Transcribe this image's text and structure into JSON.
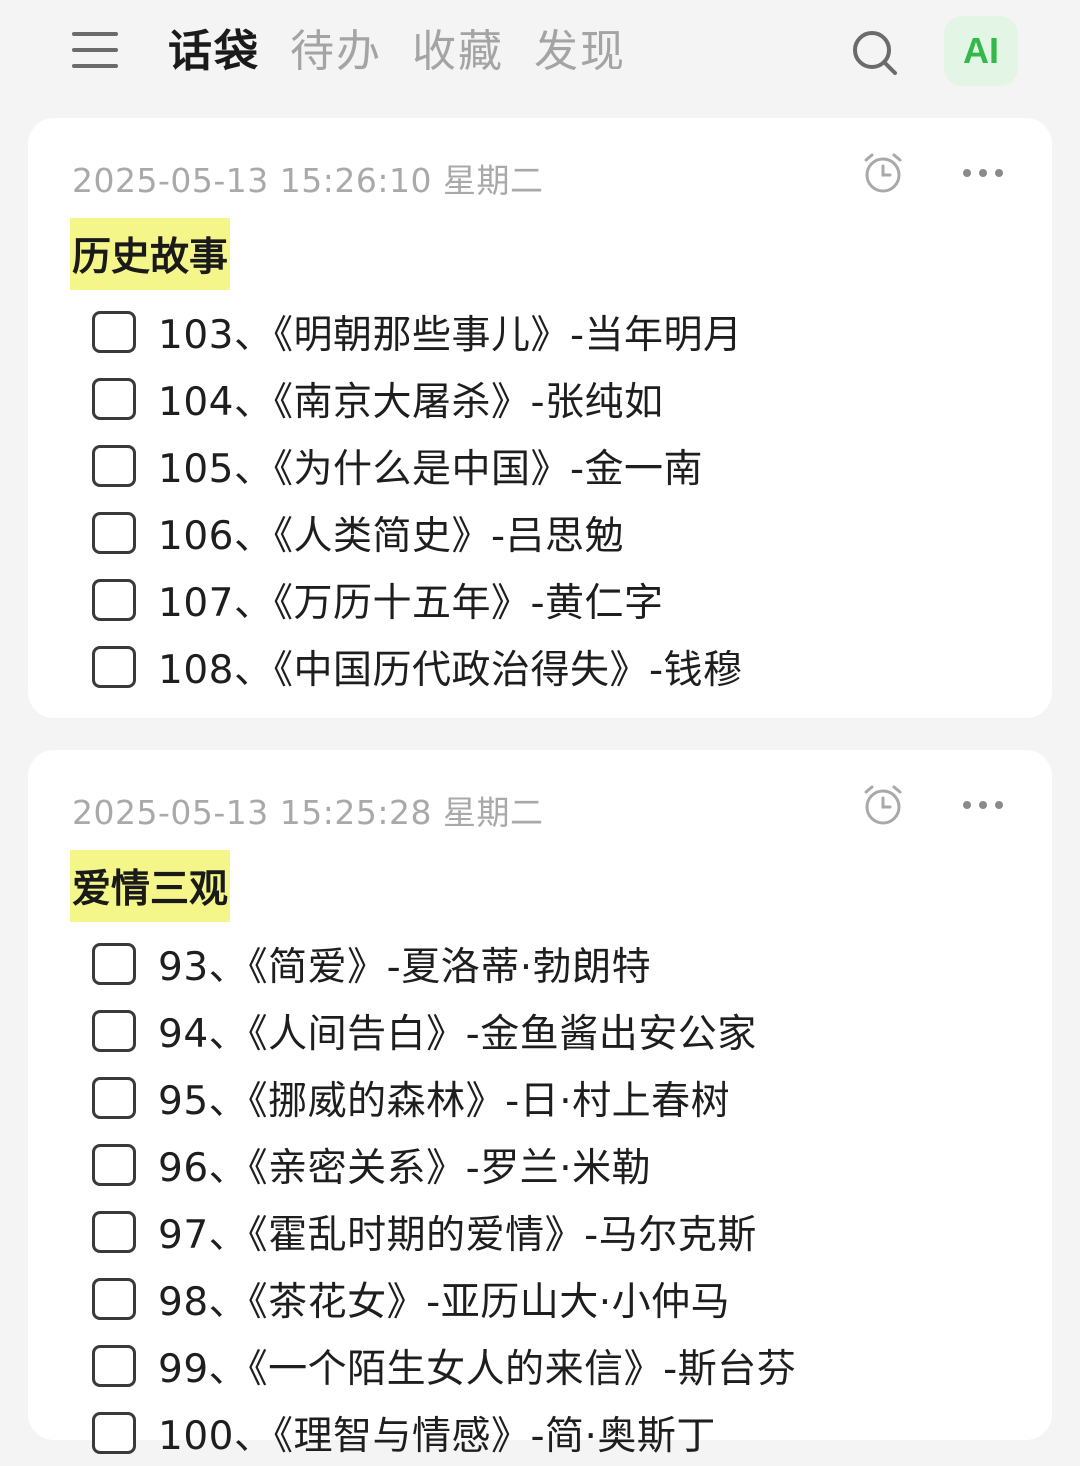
{
  "header": {
    "tabs": [
      {
        "label": "话袋",
        "active": true
      },
      {
        "label": "待办",
        "active": false
      },
      {
        "label": "收藏",
        "active": false
      },
      {
        "label": "发现",
        "active": false
      }
    ],
    "ai_label": "AI",
    "icons": {
      "menu": "hamburger-menu-icon",
      "search": "search-icon"
    },
    "colors": {
      "accent": "#33b84a",
      "highlight": "#f4f68a"
    }
  },
  "notes": [
    {
      "timestamp": "2025-05-13 15:26:10 星期二",
      "category": "历史故事",
      "items": [
        "103、《明朝那些事儿》-当年明月",
        "104、《南京大屠杀》-张纯如",
        "105、《为什么是中国》-金一南",
        "106、《人类简史》-吕思勉",
        "107、《万历十五年》-黄仁字",
        "108、《中国历代政治得失》-钱穆"
      ]
    },
    {
      "timestamp": "2025-05-13 15:25:28 星期二",
      "category": "爱情三观",
      "items": [
        "93、《简爱》-夏洛蒂·勃朗特",
        "94、《人间告白》-金鱼酱出安公家",
        "95、《挪威的森林》-日·村上春树",
        "96、《亲密关系》-罗兰·米勒",
        "97、《霍乱时期的爱情》-马尔克斯",
        "98、《茶花女》-亚历山大·小仲马",
        "99、《一个陌生女人的来信》-斯台芬",
        "100、《理智与情感》-简·奥斯丁"
      ]
    }
  ]
}
